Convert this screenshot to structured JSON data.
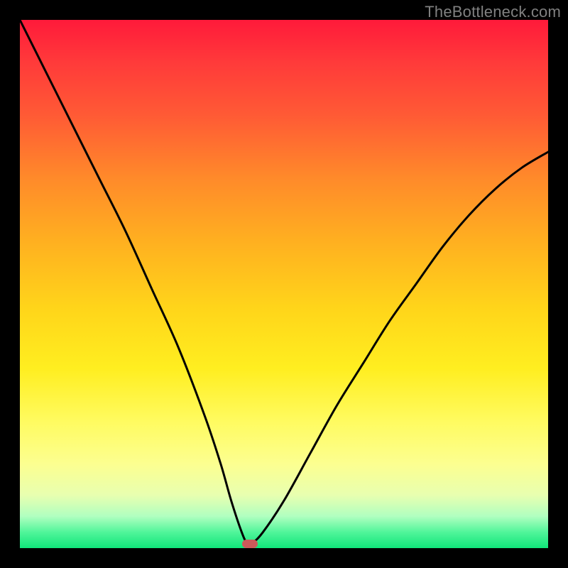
{
  "watermark": {
    "text": "TheBottleneck.com"
  },
  "chart_data": {
    "type": "line",
    "title": "",
    "xlabel": "",
    "ylabel": "",
    "xlim": [
      0,
      100
    ],
    "ylim": [
      0,
      100
    ],
    "grid": false,
    "series": [
      {
        "name": "bottleneck-curve",
        "x": [
          0,
          5,
          10,
          15,
          20,
          25,
          30,
          35,
          38,
          40,
          42,
          43,
          44,
          46,
          50,
          55,
          60,
          65,
          70,
          75,
          80,
          85,
          90,
          95,
          100
        ],
        "y": [
          100,
          90,
          80,
          70,
          60,
          49,
          38,
          25,
          16,
          9,
          3,
          1,
          1,
          3,
          9,
          18,
          27,
          35,
          43,
          50,
          57,
          63,
          68,
          72,
          75
        ]
      }
    ],
    "marker": {
      "name": "optimum-marker",
      "x": 43.5,
      "y": 0.5,
      "color": "#cc5a5a"
    },
    "background_gradient": {
      "top": "#ff1a3a",
      "mid": "#ffd61a",
      "bottom": "#10e57a"
    }
  }
}
